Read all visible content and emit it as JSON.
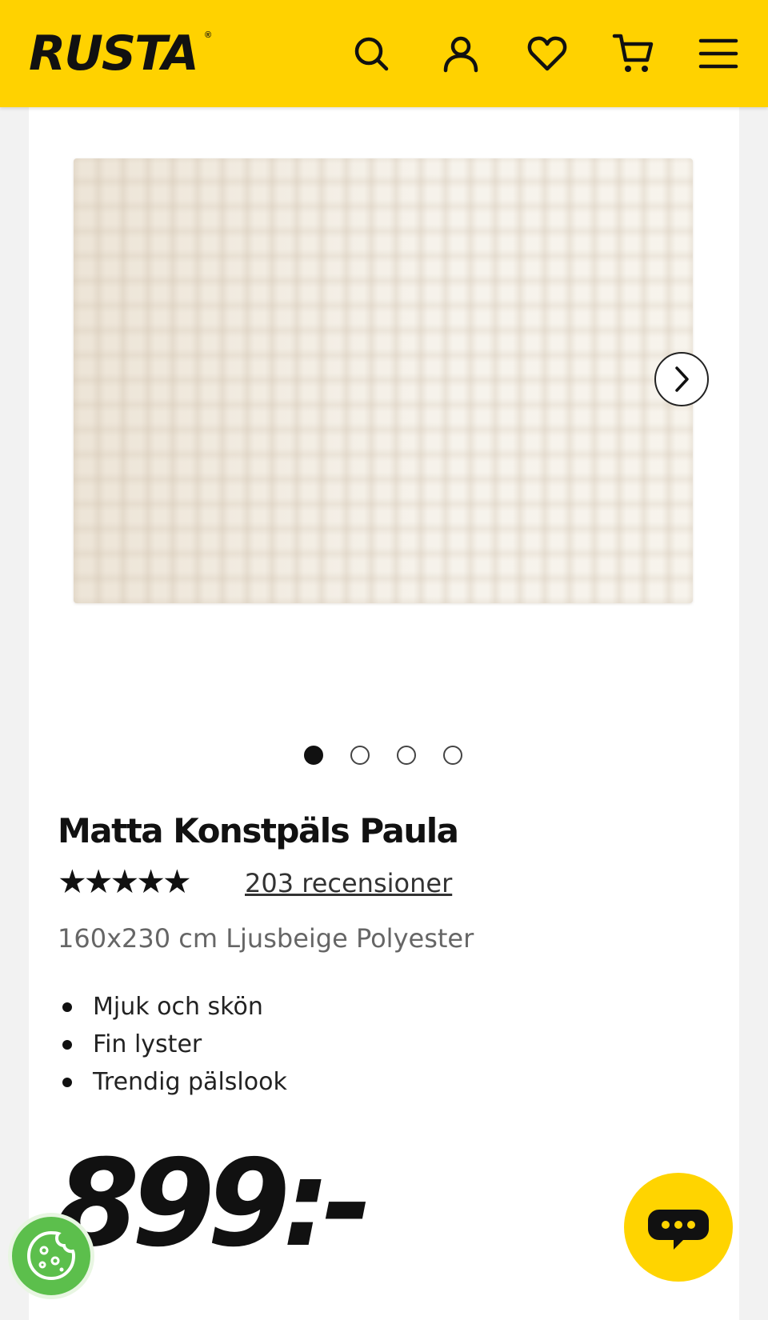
{
  "header": {
    "logo_text": "RUSTA",
    "logo_registered": "®",
    "brand_color": "#ffd200",
    "icons": [
      "search-icon",
      "account-icon",
      "heart-icon",
      "cart-icon",
      "menu-icon"
    ]
  },
  "gallery": {
    "image_alt": "Matta Konstpäls Paula",
    "slide_count": 4,
    "active_slide": 1,
    "next_icon": "chevron-right-icon"
  },
  "product": {
    "title": "Matta Konstpäls Paula",
    "rating_stars": "★★★★★",
    "rating_value": 5,
    "reviews_label": "203 recensioner",
    "subtitle": "160x230 cm Ljusbeige Polyester",
    "features": [
      "Mjuk och skön",
      "Fin lyster",
      "Trendig pälslook"
    ],
    "price": "899:-"
  },
  "floating": {
    "cookie_icon": "cookie-icon",
    "cookie_color": "#5cbf4c",
    "chat_icon": "chat-bubble-icon",
    "chat_color": "#ffd400"
  }
}
